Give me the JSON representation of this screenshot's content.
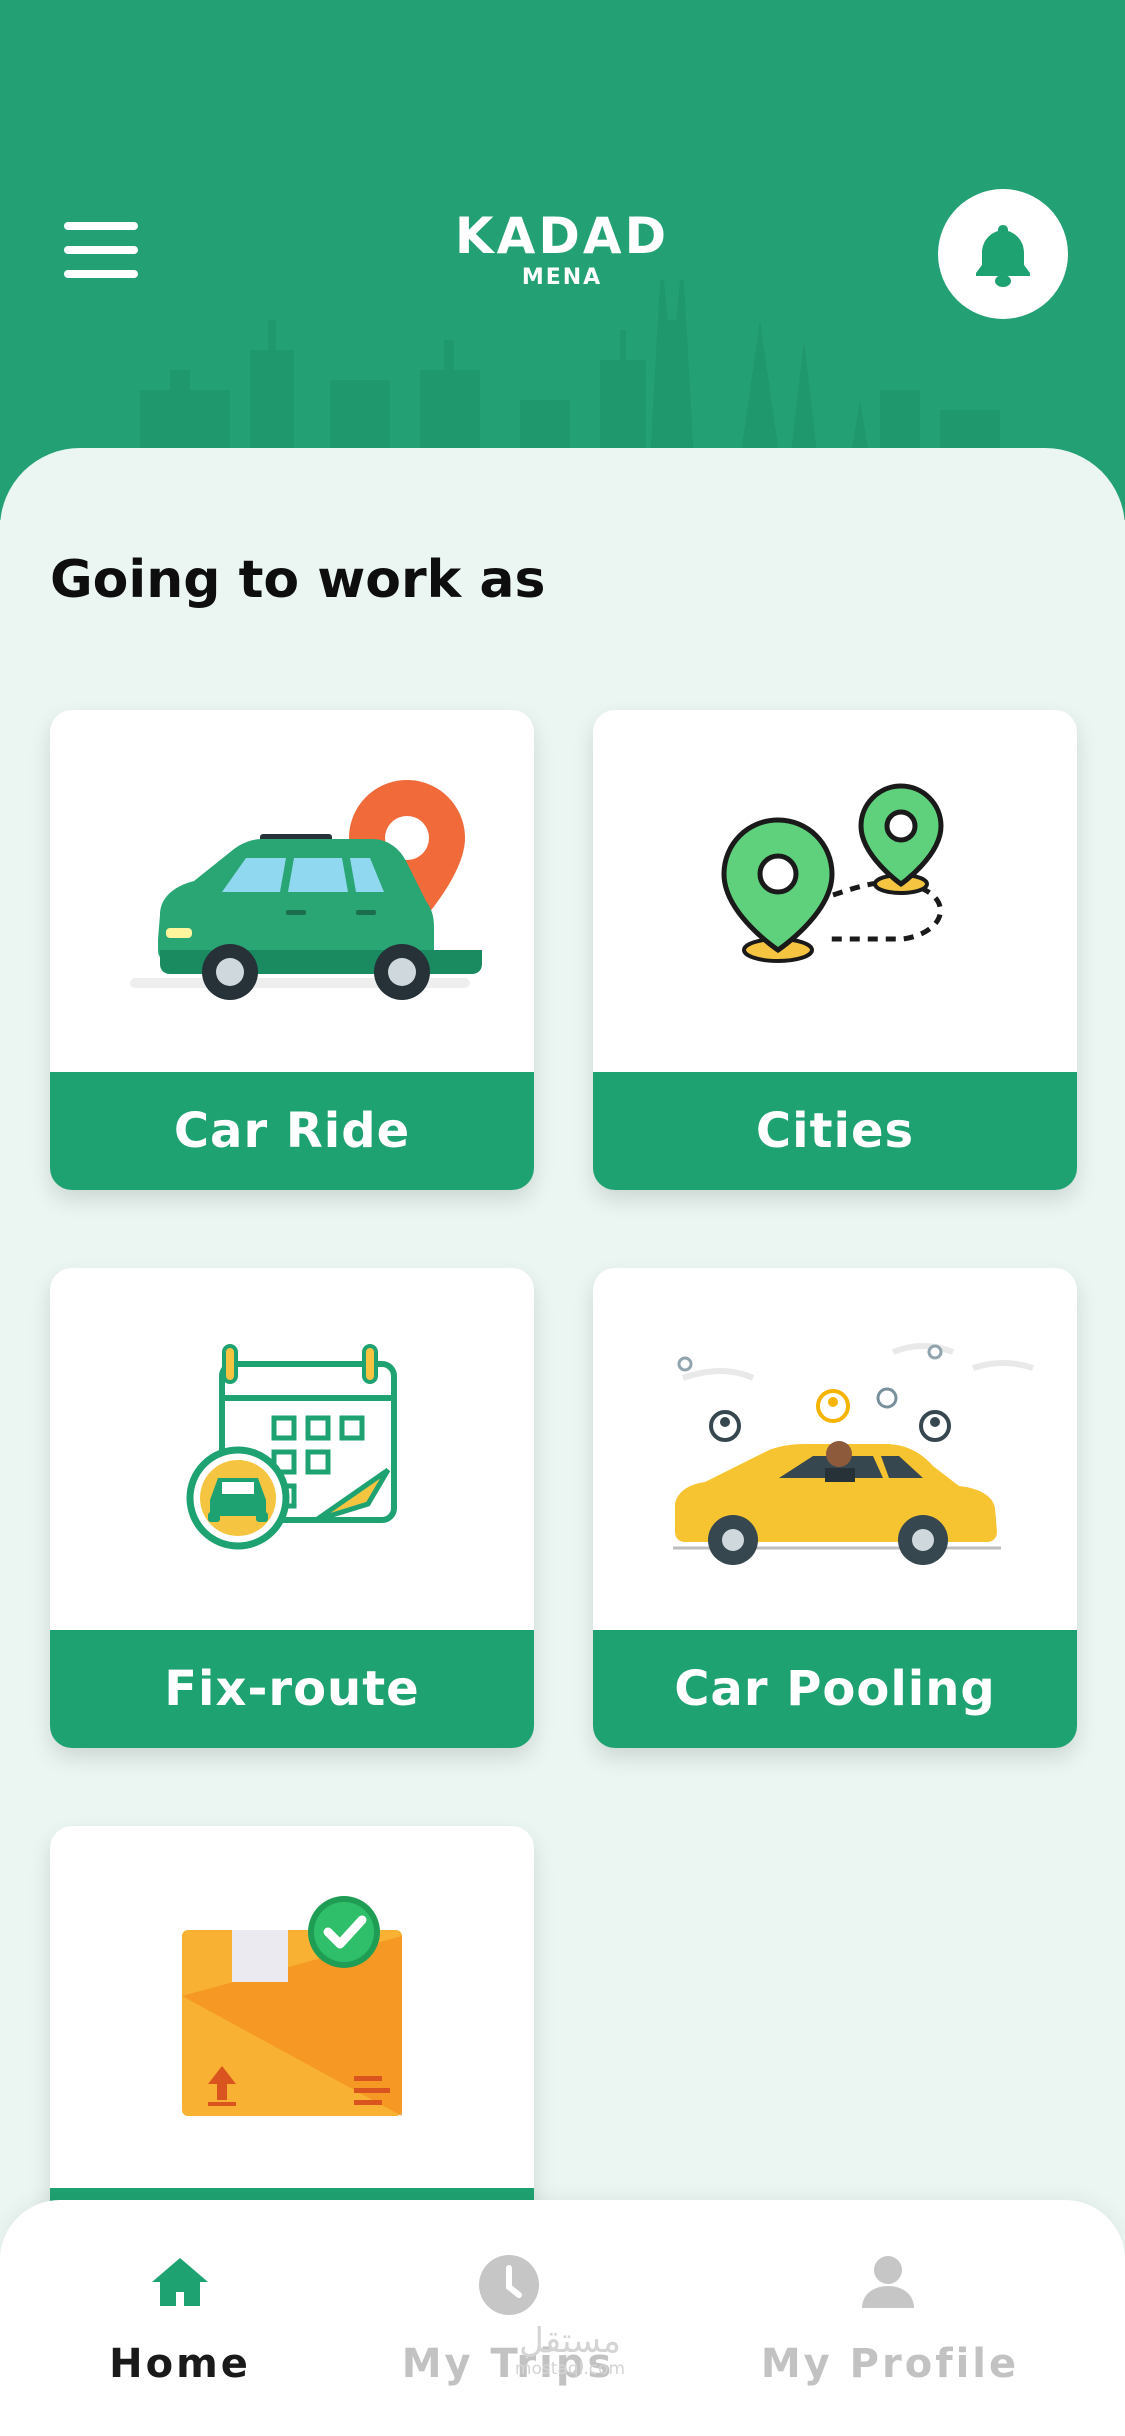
{
  "header": {
    "brand_title": "KADAD",
    "brand_subtitle": "MENA",
    "color": "#24a174"
  },
  "main": {
    "section_title": "Going to work as",
    "cards": [
      {
        "label": "Car Ride",
        "icon": "green-car-with-pin-icon"
      },
      {
        "label": "Cities",
        "icon": "location-pins-route-icon"
      },
      {
        "label": "Fix-route",
        "icon": "calendar-car-icon"
      },
      {
        "label": "Car Pooling",
        "icon": "yellow-car-with-driver-icon"
      },
      {
        "label": "",
        "icon": "package-box-icon"
      }
    ],
    "accent_color": "#1fa271"
  },
  "bottom_nav": {
    "items": [
      {
        "label": "Home",
        "icon": "home-icon",
        "active": true
      },
      {
        "label": "My Trips",
        "icon": "clock-icon",
        "active": false
      },
      {
        "label": "My Profile",
        "icon": "profile-icon",
        "active": false
      }
    ]
  },
  "watermark": {
    "arabic": "مستقل",
    "latin": "mostaql.com"
  }
}
